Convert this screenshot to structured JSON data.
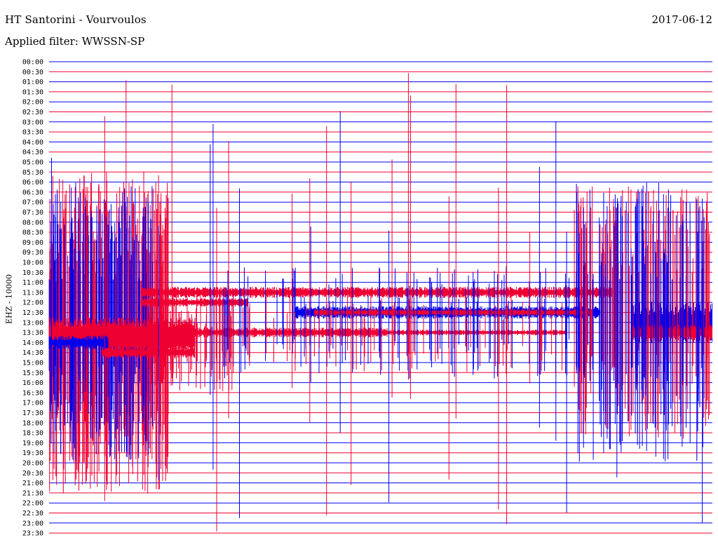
{
  "header": {
    "station": "HT Santorini - Vourvoulos",
    "date": "2017-06-12",
    "filter": "Applied filter: WWSSN-SP"
  },
  "chart_data": {
    "type": "line",
    "title": "HT Santorini - Vourvoulos",
    "ylabel": "EHZ - 10000",
    "xlabel": "",
    "grid": true,
    "trace_count": 48,
    "line_interval_minutes": 30,
    "row_labels": [
      "00:00",
      "00:30",
      "01:00",
      "01:30",
      "02:00",
      "02:30",
      "03:00",
      "03:30",
      "04:00",
      "04:30",
      "05:00",
      "05:30",
      "06:00",
      "06:30",
      "07:00",
      "07:30",
      "08:00",
      "08:30",
      "09:00",
      "09:30",
      "10:00",
      "10:30",
      "11:00",
      "11:30",
      "12:00",
      "12:30",
      "13:00",
      "13:30",
      "14:00",
      "14:30",
      "15:00",
      "15:30",
      "16:00",
      "16:30",
      "17:00",
      "17:30",
      "18:00",
      "18:30",
      "19:00",
      "19:30",
      "20:00",
      "20:30",
      "21:00",
      "21:30",
      "22:00",
      "22:30",
      "23:00",
      "23:30"
    ],
    "colors": {
      "odd": "#0000ee",
      "even": "#ee0033"
    },
    "activity": [
      {
        "time": "13:30",
        "relative_amplitude": 0.95,
        "color": "red",
        "span": [
          0.0,
          0.27
        ]
      },
      {
        "time": "14:00",
        "relative_amplitude": 0.2,
        "color": "blue",
        "span": [
          0.0,
          0.08
        ]
      },
      {
        "time": "11:30",
        "relative_amplitude": 0.5,
        "color": "red",
        "span": [
          0.15,
          0.85
        ]
      },
      {
        "time": "12:30",
        "relative_amplitude": 0.35,
        "color": "blue",
        "span": [
          0.36,
          0.83
        ]
      },
      {
        "time": "13:30",
        "relative_amplitude": 0.4,
        "color": "red",
        "span": [
          0.27,
          0.51
        ]
      },
      {
        "time": "13:00",
        "relative_amplitude": 0.9,
        "color": "blue",
        "span": [
          0.87,
          1.0
        ]
      }
    ]
  }
}
